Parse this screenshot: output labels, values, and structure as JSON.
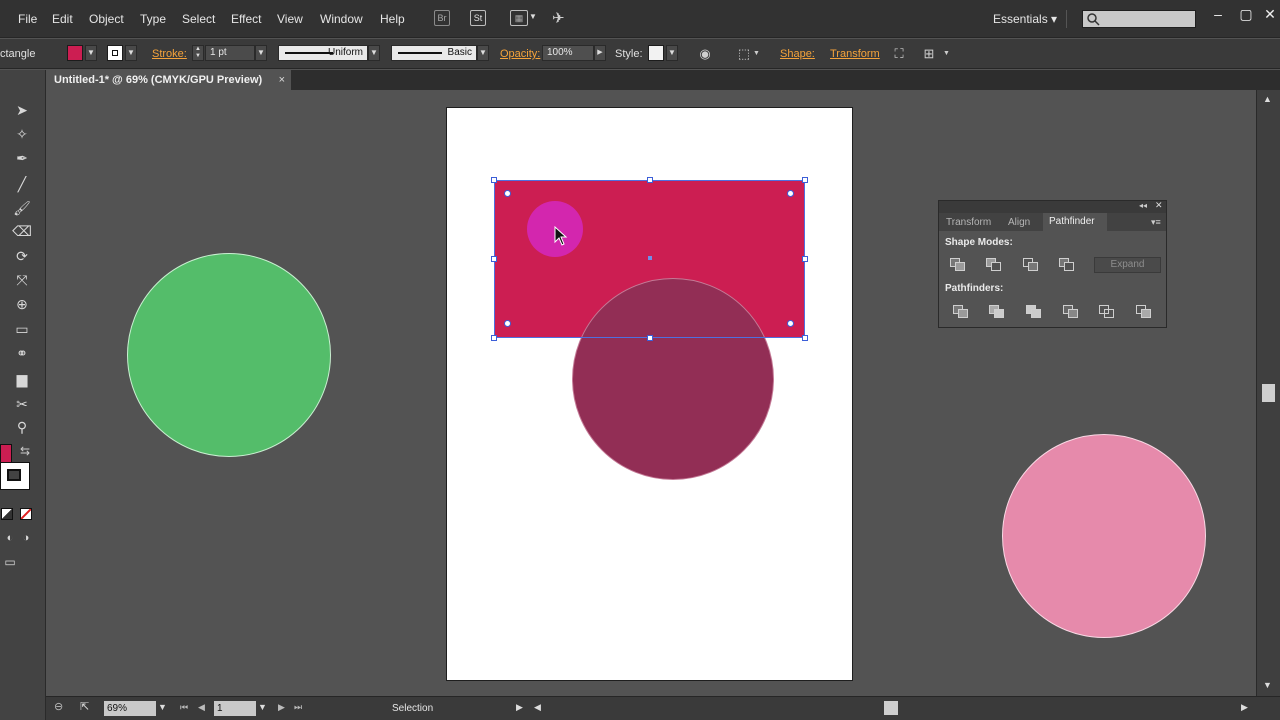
{
  "menubar": {
    "items": [
      "File",
      "Edit",
      "Object",
      "Type",
      "Select",
      "Effect",
      "View",
      "Window",
      "Help"
    ],
    "bridge_icon": "Br",
    "stock_icon": "St",
    "workspace": "Essentials",
    "workspace_arrow": "▾",
    "search_placeholder": ""
  },
  "controlbar": {
    "object_type": "ctangle",
    "fill_color": "#cc1e52",
    "stroke_label": "Stroke:",
    "stroke_weight": "1 pt",
    "stroke_profile": "Uniform",
    "brush_definition": "Basic",
    "opacity_label": "Opacity:",
    "opacity_value": "100%",
    "style_label": "Style:",
    "shape_link": "Shape:",
    "transform_link": "Transform"
  },
  "document": {
    "tab_title": "Untitled-1* @ 69% (CMYK/GPU Preview)",
    "close": "×"
  },
  "statusbar": {
    "zoom": "69%",
    "page": "1",
    "tool_status": "Selection"
  },
  "pathfinder": {
    "tabs": [
      "Transform",
      "Align",
      "Pathfinder"
    ],
    "shape_modes_label": "Shape Modes:",
    "pathfinders_label": "Pathfinders:",
    "expand_label": "Expand"
  },
  "colors": {
    "rectangle": "#cc1e52",
    "green_circle": "#54bd6a",
    "wine_circle": "#922e55",
    "pink_circle": "#e68aab",
    "selection": "#3c5fd8",
    "accent_link": "#f5a33a"
  },
  "icons": {
    "selection_tool": "arrow-icon",
    "pen_tool": "pen-icon",
    "zoom_tool": "magnifier-icon",
    "search": "search-icon"
  }
}
